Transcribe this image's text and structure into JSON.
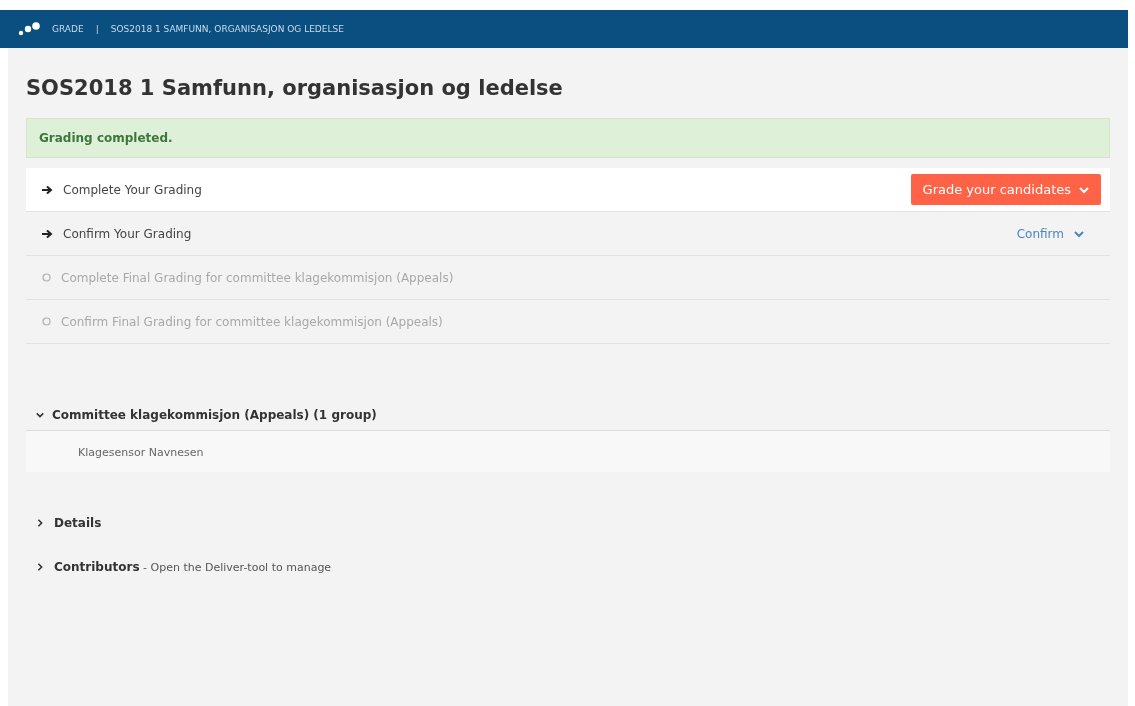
{
  "header": {
    "section": "GRADE",
    "separator": "|",
    "course": "SOS2018 1 SAMFUNN, ORGANISASJON OG LEDELSE"
  },
  "title": "SOS2018 1 Samfunn, organisasjon og ledelse",
  "alert": "Grading completed.",
  "steps": [
    {
      "label": "Complete Your Grading",
      "disabled": false,
      "selected": true,
      "action": {
        "kind": "button",
        "label": "Grade your candidates"
      }
    },
    {
      "label": "Confirm Your Grading",
      "disabled": false,
      "selected": false,
      "action": {
        "kind": "link",
        "label": "Confirm"
      }
    },
    {
      "label": "Complete Final Grading for committee klagekommisjon (Appeals)",
      "disabled": true,
      "selected": false
    },
    {
      "label": "Confirm Final Grading for committee klagekommisjon (Appeals)",
      "disabled": true,
      "selected": false
    }
  ],
  "committee": {
    "title": "Committee klagekommisjon (Appeals) (1 group)",
    "expanded": true,
    "members": [
      "Klagesensor Navnesen"
    ]
  },
  "sections": [
    {
      "text": "**Details**",
      "expanded": false
    },
    {
      "text": "**Contributors** - Open the Deliver-tool to manage",
      "expanded": false
    }
  ]
}
